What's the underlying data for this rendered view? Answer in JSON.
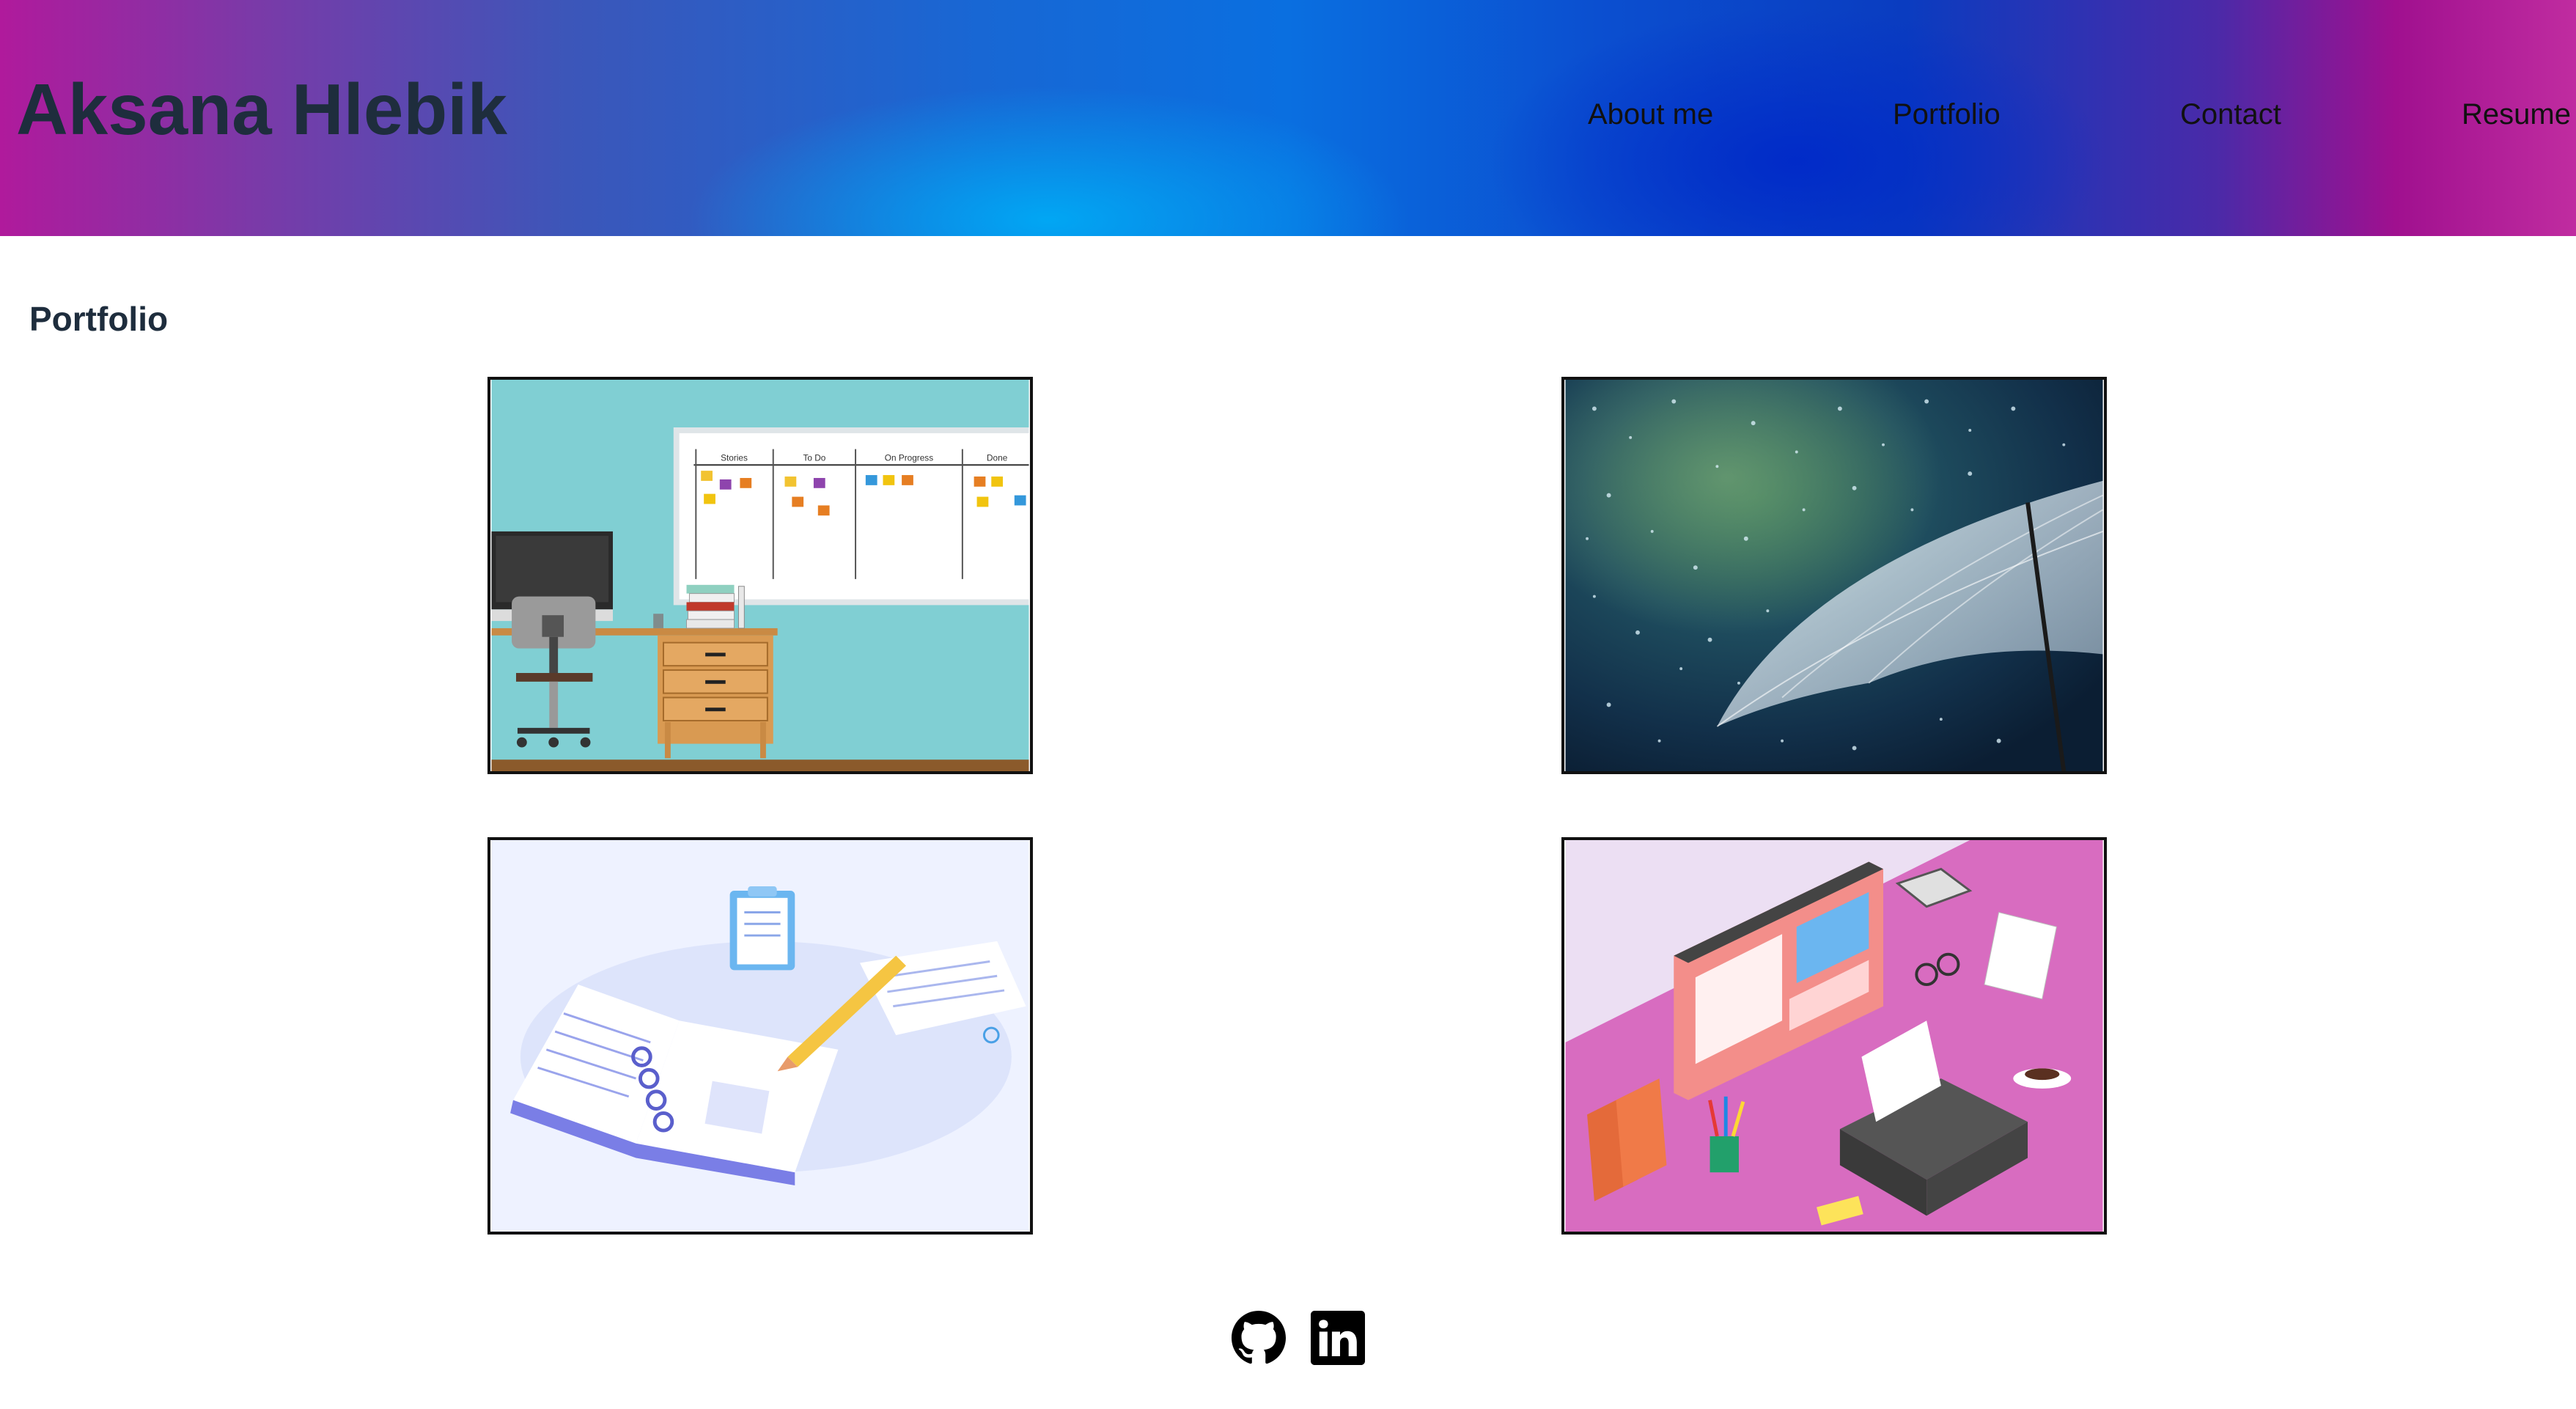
{
  "header": {
    "brand": "Aksana Hlebik",
    "nav": [
      {
        "label": "About me"
      },
      {
        "label": "Portfolio"
      },
      {
        "label": "Contact"
      },
      {
        "label": "Resume"
      }
    ]
  },
  "main": {
    "section_title": "Portfolio",
    "kanban_columns": [
      "Stories",
      "To Do",
      "On Progress",
      "Done"
    ]
  },
  "footer": {
    "icons": [
      "github-icon",
      "linkedin-icon"
    ]
  },
  "colors": {
    "heading": "#1e2d3d",
    "header_gradient_left": "#b01a9c",
    "header_gradient_mid": "#0a6fe0",
    "header_gradient_right": "#c02ca0"
  }
}
